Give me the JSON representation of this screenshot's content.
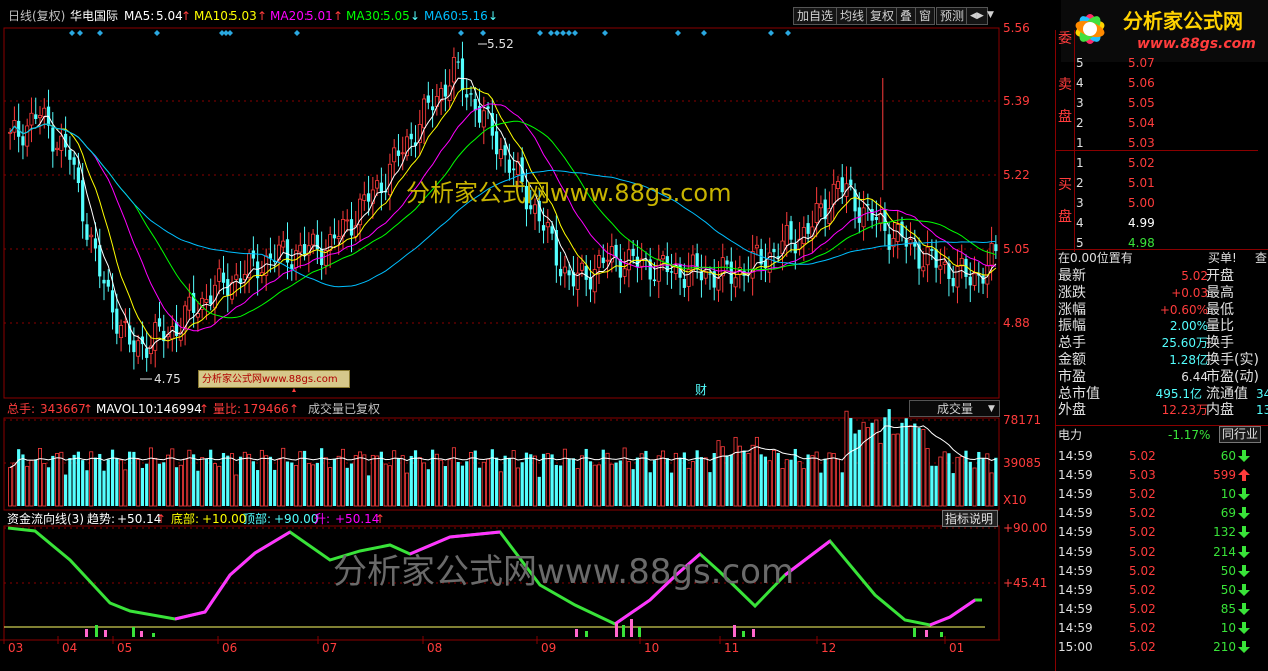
{
  "chart_header": {
    "period": "日线(复权)",
    "stock_name": "华电国际",
    "ma5_label": "MA5:",
    "ma5": "5.04",
    "ma10_label": "MA10:",
    "ma10": "5.03",
    "ma20_label": "MA20:",
    "ma20": "5.01",
    "ma30_label": "MA30:",
    "ma30": "5.05",
    "ma60_label": "MA60:",
    "ma60": "5.16",
    "up_arrow": "↑",
    "down_arrow": "↓"
  },
  "toolbar": {
    "buttons": [
      "加自选",
      "均线",
      "复权",
      "叠",
      "窗",
      "预测"
    ],
    "nav": "◀▶",
    "menu": "▼"
  },
  "colors": {
    "up": "#ff3c3c",
    "down": "#54ffff",
    "ma5": "#ffffff",
    "ma10": "#ffff00",
    "ma20": "#ff00ff",
    "ma30": "#00ff00",
    "ma60": "#00bfff",
    "axis": "#ff3c3c",
    "panel_line": "#8a0000"
  },
  "price_axis": {
    "ticks": [
      "5.56",
      "5.39",
      "5.22",
      "5.05",
      "4.88"
    ]
  },
  "price_annotations": {
    "high": "5.52",
    "low": "4.75",
    "fin_marker": "财"
  },
  "watermark": {
    "main": "分析家公式网www.88gs.com",
    "small": "分析家公式网www.88gs.com",
    "bottom": "分析家公式网www.88gs.com"
  },
  "logo": {
    "title": "分析家公式网",
    "url": "www.88gs.com"
  },
  "volume_header": {
    "total_label": "总手:",
    "total": "343667",
    "mavol_label": "MAVOL10:",
    "mavol": "146994",
    "ratio_label": "量比:",
    "ratio": "179466",
    "note": "成交量已复权",
    "select": "成交量"
  },
  "volume_axis": {
    "ticks": [
      "78171",
      "39085"
    ],
    "unit": "X10"
  },
  "indicator_header": {
    "name": "资金流向线(3)",
    "trend_label": "趋势:",
    "trend": "+50.14",
    "bottom_label": "底部:",
    "bottom": "+10.00",
    "top_label": "顶部:",
    "top": "+90.00",
    "rise_label": "升:",
    "rise": "+50.14",
    "help": "指标说明"
  },
  "indicator_axis": {
    "ticks": [
      "+90.00",
      "+45.41"
    ]
  },
  "date_axis": {
    "labels": [
      "03",
      "04",
      "05",
      "06",
      "07",
      "08",
      "09",
      "10",
      "11",
      "12",
      "01"
    ]
  },
  "order_book": {
    "side_weibi": "委",
    "side_sell": [
      "卖",
      "盘"
    ],
    "side_buy": [
      "买",
      "盘"
    ],
    "sell": [
      {
        "lvl": "5",
        "price": "5.07"
      },
      {
        "lvl": "4",
        "price": "5.06"
      },
      {
        "lvl": "3",
        "price": "5.05"
      },
      {
        "lvl": "2",
        "price": "5.04"
      },
      {
        "lvl": "1",
        "price": "5.03"
      }
    ],
    "buy": [
      {
        "lvl": "1",
        "price": "5.02"
      },
      {
        "lvl": "2",
        "price": "5.01"
      },
      {
        "lvl": "3",
        "price": "5.00"
      },
      {
        "lvl": "4",
        "price": "4.99"
      },
      {
        "lvl": "5",
        "price": "4.98"
      }
    ],
    "position_text": "在0.00位置有",
    "buy_order": "买单!",
    "query": "查"
  },
  "quote": [
    {
      "l": "最新",
      "v": "5.02",
      "r": "开盘"
    },
    {
      "l": "涨跌",
      "v": "+0.03",
      "r": "最高"
    },
    {
      "l": "涨幅",
      "v": "+0.60%",
      "r": "最低"
    },
    {
      "l": "振幅",
      "v": "2.00%",
      "r": "量比"
    },
    {
      "l": "总手",
      "v": "25.60万",
      "r": "换手"
    },
    {
      "l": "金额",
      "v": "1.28亿",
      "r": "换手(实)"
    },
    {
      "l": "市盈",
      "v": "6.44",
      "r": "市盈(动)"
    },
    {
      "l": "总市值",
      "v": "495.1亿",
      "r": "流通值",
      "r2": "34"
    },
    {
      "l": "外盘",
      "v": "12.23万",
      "r": "内盘",
      "r2": "13"
    }
  ],
  "industry": {
    "name": "电力",
    "change": "-1.17%",
    "button": "同行业"
  },
  "ticks": [
    {
      "time": "14:59",
      "price": "5.02",
      "vol": "60",
      "dir": "down"
    },
    {
      "time": "14:59",
      "price": "5.03",
      "vol": "599",
      "dir": "up"
    },
    {
      "time": "14:59",
      "price": "5.02",
      "vol": "10",
      "dir": "down"
    },
    {
      "time": "14:59",
      "price": "5.02",
      "vol": "69",
      "dir": "down"
    },
    {
      "time": "14:59",
      "price": "5.02",
      "vol": "132",
      "dir": "down"
    },
    {
      "time": "14:59",
      "price": "5.02",
      "vol": "214",
      "dir": "down"
    },
    {
      "time": "14:59",
      "price": "5.02",
      "vol": "50",
      "dir": "down"
    },
    {
      "time": "14:59",
      "price": "5.02",
      "vol": "50",
      "dir": "down"
    },
    {
      "time": "14:59",
      "price": "5.02",
      "vol": "85",
      "dir": "down"
    },
    {
      "time": "14:59",
      "price": "5.02",
      "vol": "10",
      "dir": "down"
    },
    {
      "time": "15:00",
      "price": "5.02",
      "vol": "210",
      "dir": "down"
    }
  ]
}
